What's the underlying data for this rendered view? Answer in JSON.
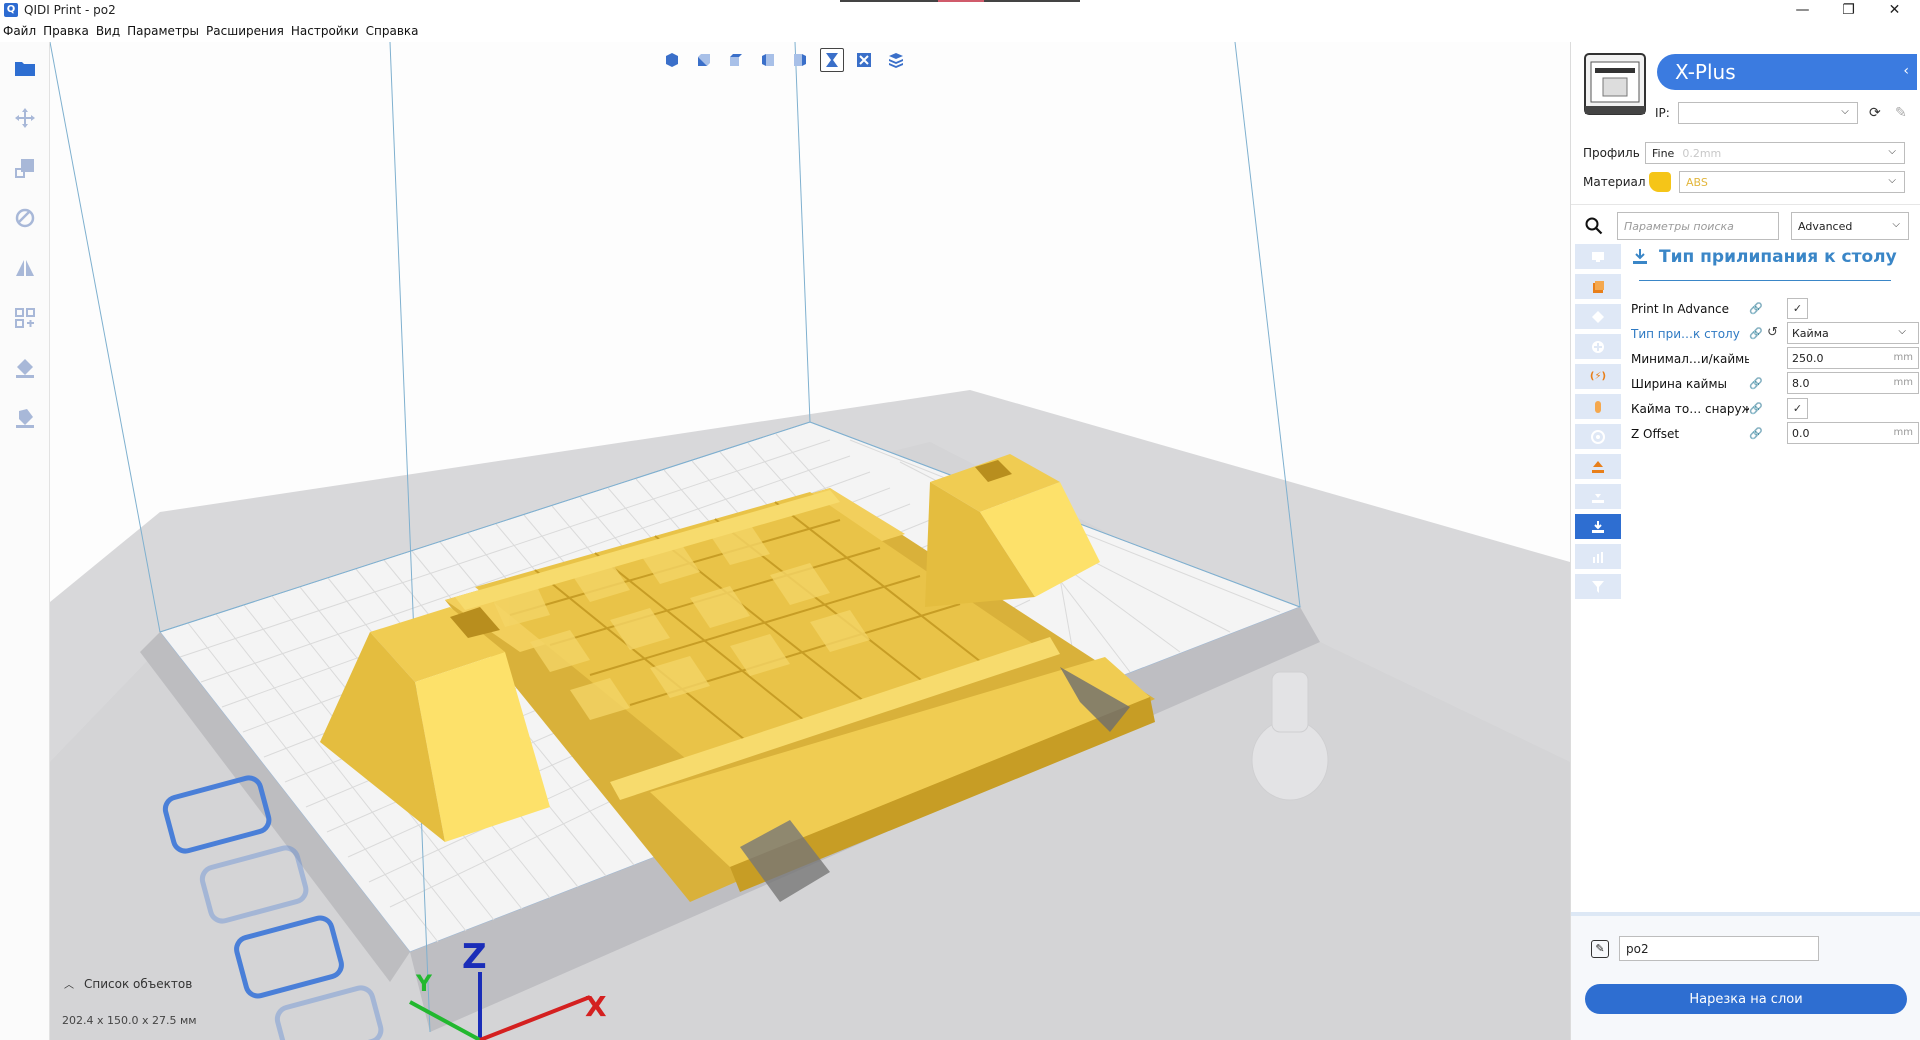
{
  "window": {
    "title": "QIDI Print - po2",
    "app_icon_glyph": "Q",
    "controls": {
      "minimize": "—",
      "maximize": "❐",
      "close": "✕"
    }
  },
  "menu": [
    "Файл",
    "Правка",
    "Вид",
    "Параметры",
    "Расширения",
    "Настройки",
    "Справка"
  ],
  "left_toolbar": [
    "open-folder-icon",
    "move-icon",
    "scale-icon",
    "rotate-icon",
    "mirror-icon",
    "per-model-settings-icon",
    "support-blocker-icon",
    "support-eraser-icon"
  ],
  "view_toolbar": [
    "view-3d-icon",
    "view-front-icon",
    "view-top-icon",
    "view-left-icon",
    "view-right-icon",
    "x-ray-icon",
    "compatibility-icon",
    "layer-view-icon"
  ],
  "viewport": {
    "objects_label": "Список объектов",
    "dimensions": "202.4 x 150.0 x 27.5 мм",
    "axes": {
      "z": "Z",
      "y": "Y",
      "x": "X"
    }
  },
  "printer": {
    "name": "X-Plus",
    "ip_label": "IP:",
    "ip_value": ""
  },
  "profile": {
    "label": "Профиль",
    "value": "Fine",
    "hint": "0.2mm"
  },
  "material": {
    "label": "Материал",
    "value": "ABS",
    "color": "#f5c518"
  },
  "search": {
    "placeholder": "Параметры поиска",
    "mode": "Advanced"
  },
  "categories": [
    "printer-icon",
    "shell-icon",
    "infill-icon",
    "material-icon",
    "speed-icon",
    "cooling-icon",
    "support-icon",
    "travel-icon",
    "adhesion-icon",
    "dual-extrusion-icon",
    "mesh-fixes-icon"
  ],
  "active_category": 9,
  "section": {
    "title": "Тип прилипания к столу",
    "icon": "adhesion-icon"
  },
  "settings": [
    {
      "name": "Print In Advance",
      "type": "check",
      "checked": true
    },
    {
      "name": "Тип при…к столу",
      "type": "select",
      "value": "Кайма",
      "modified": true
    },
    {
      "name": "Минимал…и/каймы",
      "type": "number",
      "value": "250.0",
      "unit": "mm"
    },
    {
      "name": "Ширина каймы",
      "type": "number",
      "value": "8.0",
      "unit": "mm"
    },
    {
      "name": "Кайма то… снаружи",
      "type": "check",
      "checked": true
    },
    {
      "name": "Z Offset",
      "type": "number",
      "value": "0.0",
      "unit": "mm"
    }
  ],
  "job": {
    "name": "po2"
  },
  "slice_button": "Нарезка на слои",
  "colors": {
    "accent": "#2e6ed1",
    "model": "#f2cf5c",
    "model_dark": "#d9b13a",
    "grid": "#e9e9e9"
  }
}
